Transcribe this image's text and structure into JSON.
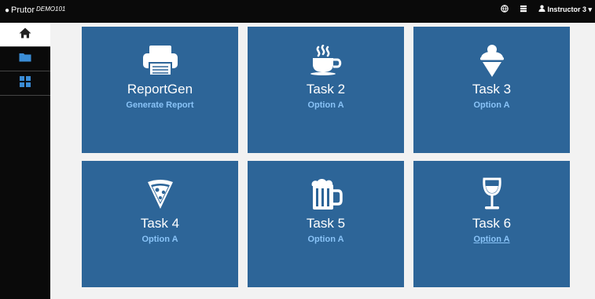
{
  "header": {
    "brand": "Prutor",
    "course": "DEMO101",
    "user": "Instructor 3"
  },
  "sidebar": {
    "items": [
      {
        "icon": "home-icon",
        "active": true
      },
      {
        "icon": "folder-icon",
        "active": false
      },
      {
        "icon": "grid-icon",
        "active": false
      }
    ]
  },
  "tiles": [
    {
      "icon": "printer-icon",
      "title": "ReportGen",
      "subtitle": "Generate Report"
    },
    {
      "icon": "coffee-cup-icon",
      "title": "Task 2",
      "subtitle": "Option A"
    },
    {
      "icon": "ice-cream-icon",
      "title": "Task 3",
      "subtitle": "Option A"
    },
    {
      "icon": "pizza-slice-icon",
      "title": "Task 4",
      "subtitle": "Option A"
    },
    {
      "icon": "beer-mug-icon",
      "title": "Task 5",
      "subtitle": "Option A"
    },
    {
      "icon": "wine-glass-icon",
      "title": "Task 6",
      "subtitle": "Option A"
    }
  ],
  "colors": {
    "tile": "#2d6598",
    "subtitle": "#89c3f7",
    "nav": "#0a0a0a",
    "background": "#f2f2f2"
  }
}
